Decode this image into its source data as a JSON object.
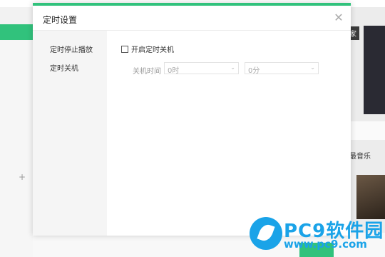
{
  "background": {
    "video_tag": "家",
    "music_label": "最音乐"
  },
  "dialog": {
    "title": "定时设置",
    "close_icon": "close-icon",
    "sidebar": {
      "items": [
        {
          "label": "定时停止播放"
        },
        {
          "label": "定时关机"
        }
      ]
    },
    "shutdown": {
      "checkbox_label": "开启定时关机",
      "checked": false,
      "time_label": "关机时间",
      "hour_value": "0时",
      "minute_value": "0分"
    }
  },
  "watermark": {
    "brand": "PC9软件园",
    "url": "www.pc9.com"
  },
  "colors": {
    "accent": "#31c27c",
    "watermark": "#1aa3e8"
  }
}
